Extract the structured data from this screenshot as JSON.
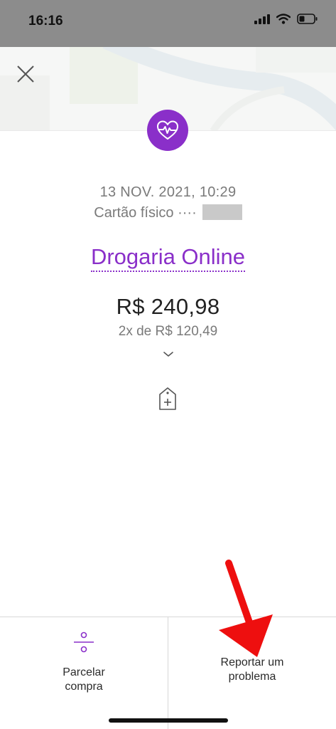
{
  "status_bar": {
    "time": "16:16"
  },
  "header": {
    "close_icon": "close-icon"
  },
  "transaction": {
    "category_icon": "heart-pulse-icon",
    "date": "13 NOV. 2021, 10:29",
    "card_label": "Cartão físico ····",
    "merchant": "Drogaria Online",
    "amount": "R$ 240,98",
    "installments": "2x de R$ 120,49"
  },
  "actions": {
    "installment_label": "Parcelar\ncompra",
    "report_label": "Reportar um\nproblema"
  },
  "colors": {
    "accent": "#8a2fc9",
    "status_bar": "#8c8c8c",
    "annotation_arrow": "#ee0f0f"
  }
}
